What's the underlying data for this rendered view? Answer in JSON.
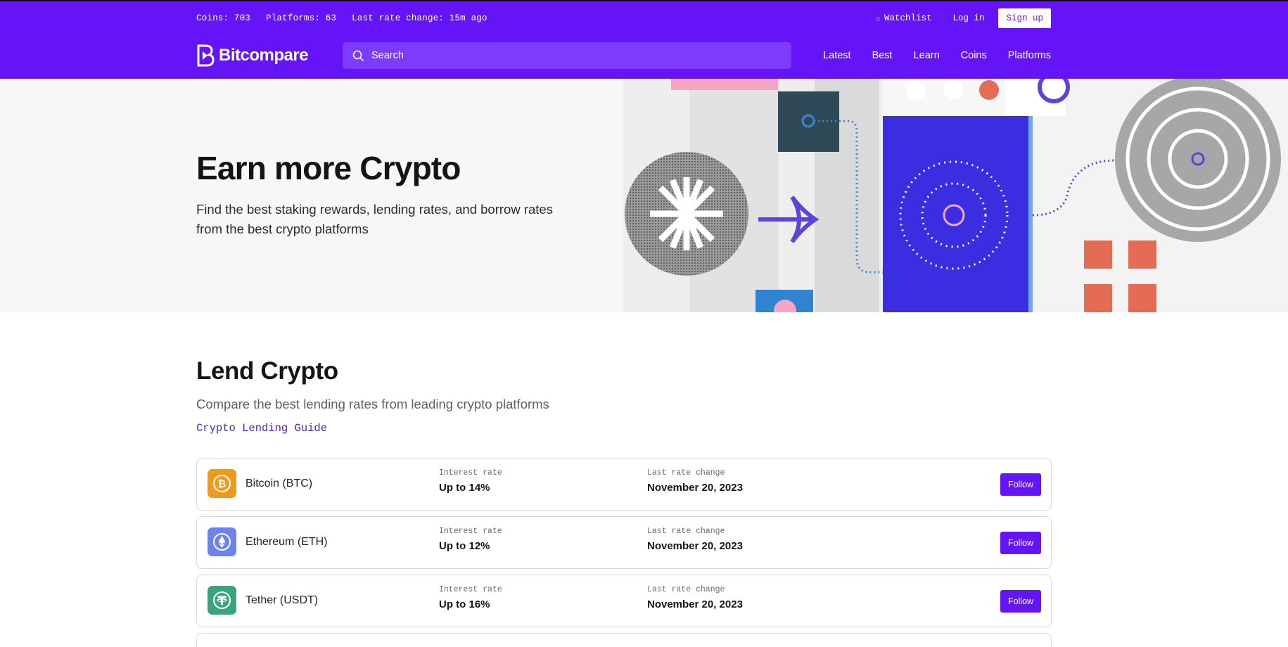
{
  "topbar": {
    "coins": "Coins: 703",
    "platforms": "Platforms: 63",
    "last_change": "Last rate change: 15m ago",
    "watchlist": "Watchlist",
    "login": "Log in",
    "signup": "Sign up"
  },
  "navbar": {
    "logo": "Bitcompare",
    "search_placeholder": "Search",
    "links": [
      "Latest",
      "Best",
      "Learn",
      "Coins",
      "Platforms"
    ]
  },
  "hero": {
    "title": "Earn more Crypto",
    "subtitle_line1": "Find the best staking rewards, lending rates, and borrow rates",
    "subtitle_line2": "from the best crypto platforms"
  },
  "lend": {
    "title": "Lend Crypto",
    "subtitle": "Compare the best lending rates from leading crypto platforms",
    "guide_link": "Crypto Lending Guide",
    "rate_label": "Interest rate",
    "change_label": "Last rate change",
    "follow_label": "Follow",
    "coins": [
      {
        "name": "Bitcoin (BTC)",
        "rate": "Up to 14%",
        "date": "November 20, 2023",
        "icon": "bitcoin-icon",
        "color": "#f09a1b"
      },
      {
        "name": "Ethereum (ETH)",
        "rate": "Up to 12%",
        "date": "November 20, 2023",
        "icon": "ethereum-icon",
        "color": "#6b83ec"
      },
      {
        "name": "Tether (USDT)",
        "rate": "Up to 16%",
        "date": "November 20, 2023",
        "icon": "tether-icon",
        "color": "#3aa380"
      }
    ]
  },
  "colors": {
    "brand": "#6514f8",
    "link": "#4f25b8"
  }
}
